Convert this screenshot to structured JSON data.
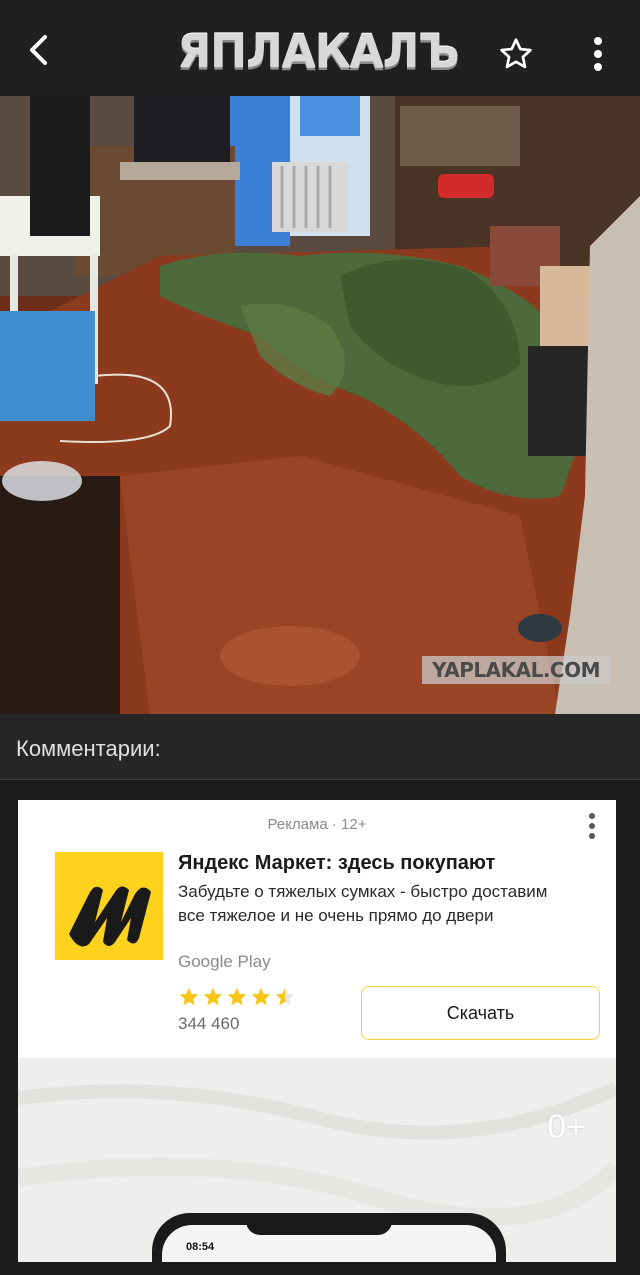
{
  "topbar": {
    "logo_text": "ЯПЛАКАЛЪ",
    "back_icon": "back-arrow-icon",
    "favorite_icon": "star-outline-icon",
    "menu_icon": "more-vertical-icon"
  },
  "post": {
    "watermark": "YAPLAKAL.COM"
  },
  "comments": {
    "title": "Комментарии:"
  },
  "ad": {
    "label": "Реклама · 12+",
    "title": "Яндекс Маркет: здесь покупают",
    "description": "Забудьте о тяжелых сумках - быстро доставим все тяжелое и не очень прямо до двери",
    "store": "Google Play",
    "rating": 4.5,
    "rating_count": "344 460",
    "button_label": "Скачать",
    "age_badge": "0+",
    "phone_time": "08:54",
    "brand_color": "#ffd21e",
    "star_color": "#f5c518"
  },
  "colors": {
    "background": "#1c1c1c",
    "topbar": "#202020",
    "comments_header": "#262626"
  }
}
